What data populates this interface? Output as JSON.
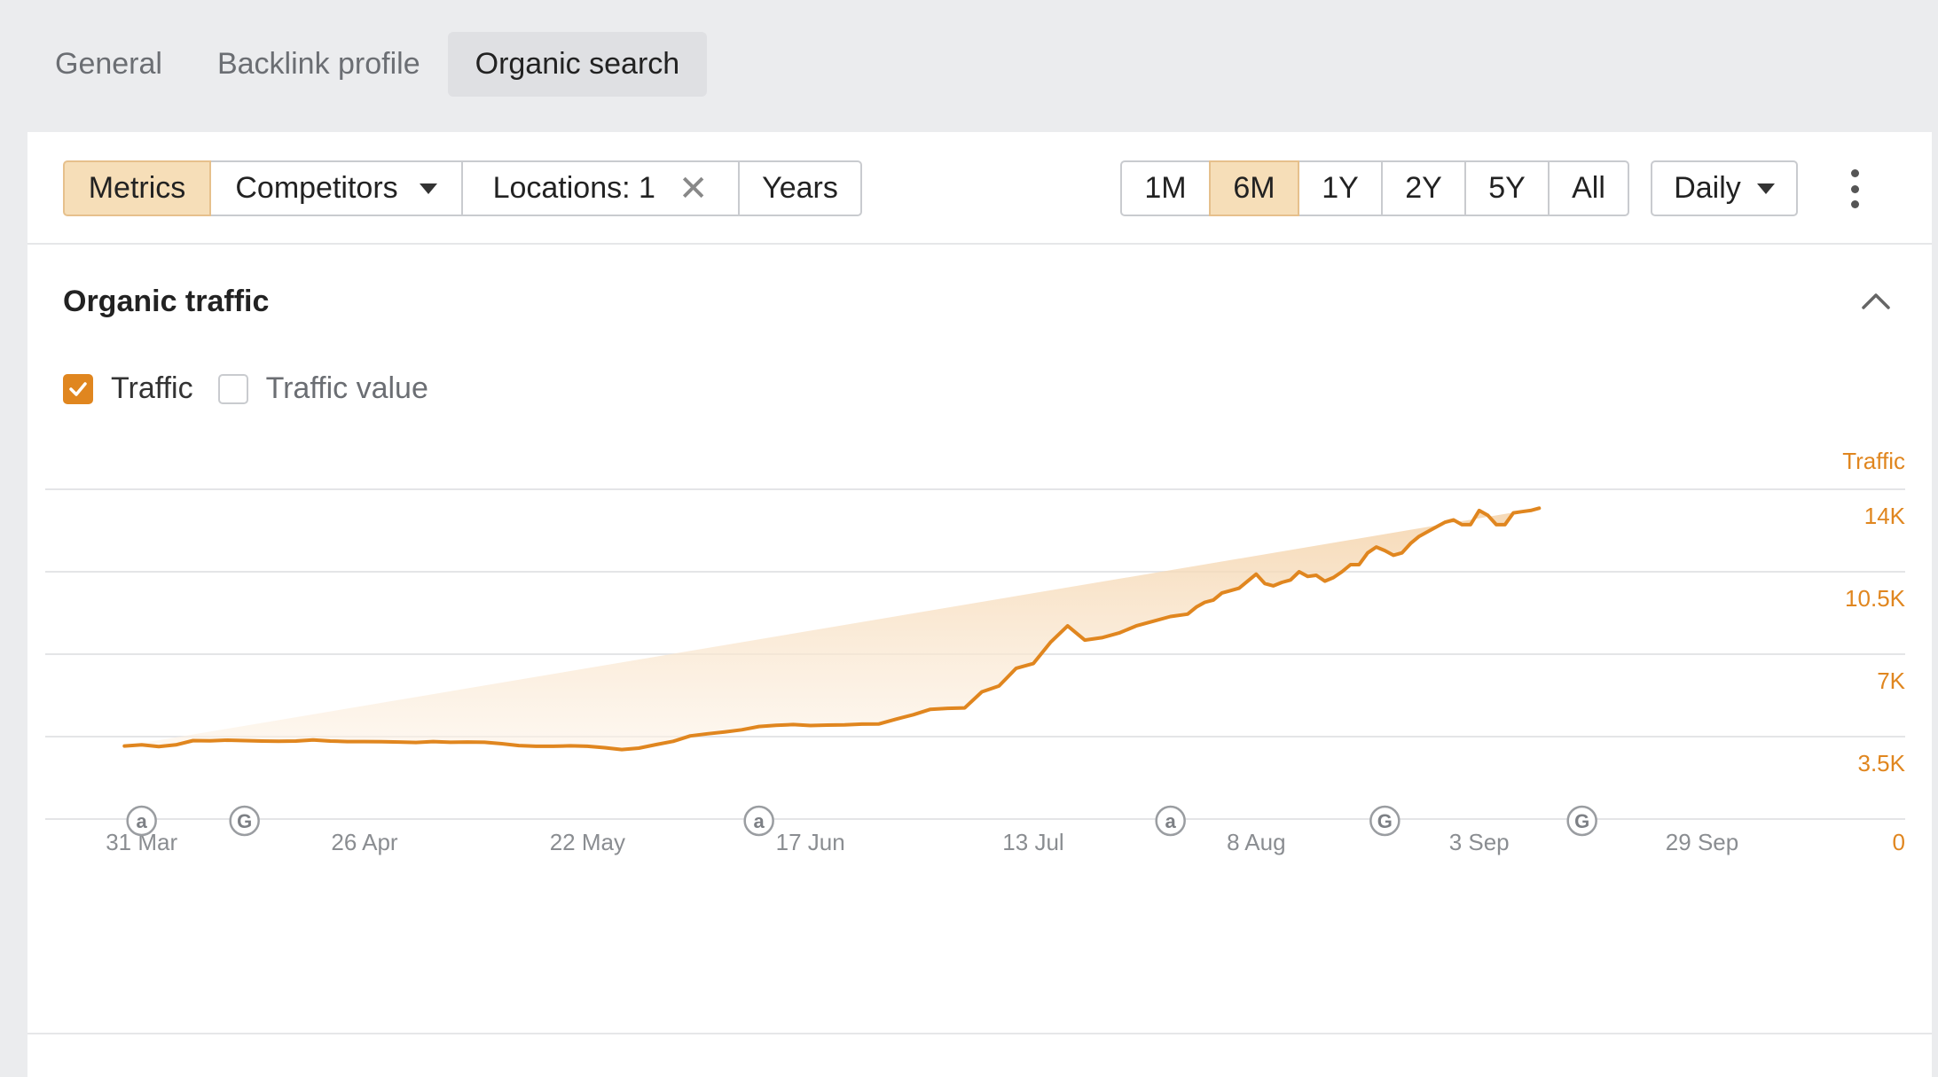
{
  "top_tabs": [
    {
      "label": "General",
      "active": false
    },
    {
      "label": "Backlink profile",
      "active": false
    },
    {
      "label": "Organic search",
      "active": true
    }
  ],
  "toolbar": {
    "metrics_label": "Metrics",
    "competitors_label": "Competitors",
    "locations_label": "Locations: 1",
    "years_label": "Years",
    "ranges": [
      {
        "label": "1M",
        "active": false
      },
      {
        "label": "6M",
        "active": true
      },
      {
        "label": "1Y",
        "active": false
      },
      {
        "label": "2Y",
        "active": false
      },
      {
        "label": "5Y",
        "active": false
      },
      {
        "label": "All",
        "active": false
      }
    ],
    "interval_label": "Daily"
  },
  "section": {
    "title": "Organic traffic",
    "legend": [
      {
        "label": "Traffic",
        "checked": true
      },
      {
        "label": "Traffic value",
        "checked": false
      }
    ]
  },
  "colors": {
    "accent": "#e0861f",
    "fill_top": "#f6dcbc",
    "grid": "#e4e5e7",
    "axis_text": "#8a8d91"
  },
  "chart_data": {
    "type": "area",
    "y_axis_title": "Traffic",
    "y_ticks": [
      "14K",
      "10.5K",
      "7K",
      "3.5K",
      "0"
    ],
    "y_tick_values": [
      14000,
      10500,
      7000,
      3500,
      0
    ],
    "ylim": [
      0,
      14000
    ],
    "x_tick_labels": [
      "31 Mar",
      "26 Apr",
      "22 May",
      "17 Jun",
      "13 Jul",
      "8 Aug",
      "3 Sep",
      "29 Sep"
    ],
    "x_tick_days": [
      4,
      30,
      56,
      82,
      108,
      134,
      160,
      186
    ],
    "xlim_days": [
      0,
      186
    ],
    "grid": true,
    "markers": [
      {
        "day": 4,
        "letter": "a"
      },
      {
        "day": 16,
        "letter": "G"
      },
      {
        "day": 76,
        "letter": "a"
      },
      {
        "day": 124,
        "letter": "a"
      },
      {
        "day": 149,
        "letter": "G"
      },
      {
        "day": 172,
        "letter": "G"
      }
    ],
    "series": [
      {
        "days": [
          2,
          4,
          6,
          8,
          10,
          12,
          14,
          16,
          18,
          20,
          22,
          24,
          26,
          28,
          30,
          32,
          34,
          36,
          38,
          40,
          42,
          44,
          46,
          48,
          50,
          52,
          54,
          56,
          58,
          60,
          62,
          64,
          66,
          68,
          70,
          72,
          74,
          76,
          78,
          80,
          82,
          84,
          86,
          88,
          90,
          92,
          94,
          96,
          98,
          100,
          102,
          104,
          106,
          108,
          110,
          112,
          114,
          116,
          118,
          120,
          122,
          124,
          126,
          127,
          128,
          129,
          130,
          131,
          132,
          133,
          134,
          135,
          136,
          137,
          138,
          139,
          140,
          141,
          142,
          143,
          144,
          145,
          146,
          147,
          148,
          149,
          150,
          151,
          152,
          153,
          154,
          155,
          156,
          157,
          158,
          159,
          160,
          161,
          162,
          163,
          164,
          165,
          166,
          167,
          168,
          169,
          170,
          171,
          172,
          173,
          174,
          175,
          176,
          177,
          178,
          179,
          180,
          181,
          182,
          183,
          184,
          185,
          186
        ],
        "values": [
          3100,
          3150,
          3080,
          3150,
          3330,
          3320,
          3350,
          3330,
          3310,
          3300,
          3310,
          3360,
          3310,
          3290,
          3290,
          3280,
          3270,
          3250,
          3290,
          3260,
          3270,
          3260,
          3200,
          3120,
          3090,
          3090,
          3110,
          3090,
          3030,
          2950,
          3010,
          3160,
          3300,
          3530,
          3620,
          3700,
          3790,
          3930,
          3980,
          4010,
          3970,
          3990,
          4000,
          4030,
          4040,
          4240,
          4430,
          4660,
          4700,
          4720,
          5400,
          5650,
          6400,
          6600,
          7500,
          8200,
          7600,
          7700,
          7900,
          8200,
          8400,
          8600,
          8700,
          9000,
          9200,
          9300,
          9600,
          9700,
          9800,
          10100,
          10400,
          10000,
          9900,
          10050,
          10150,
          10500,
          10300,
          10350,
          10100,
          10250,
          10500,
          10800,
          10800,
          11300,
          11550,
          11400,
          11200,
          11300,
          11700,
          12000,
          12200,
          12400,
          12600,
          12700,
          12500,
          12500,
          13100,
          12900,
          12500,
          12500,
          13000,
          13050,
          13100,
          13200
        ]
      }
    ]
  }
}
